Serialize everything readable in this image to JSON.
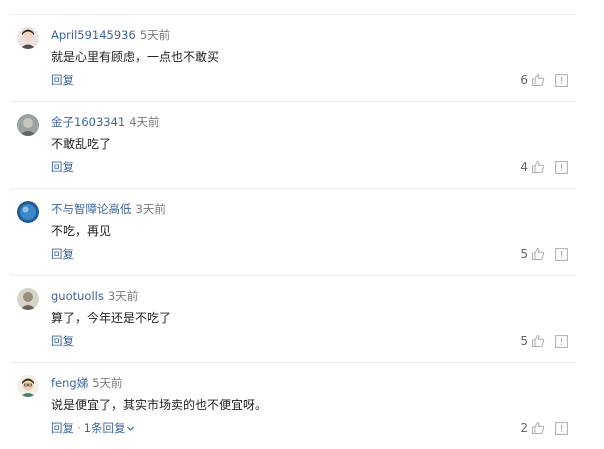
{
  "comments": [
    {
      "username": "April59145936",
      "time": "5天前",
      "content": "就是心里有顾虑，一点也不敢买",
      "reply_label": "回复",
      "likes": "6",
      "avatar_color": "#6b5a55"
    },
    {
      "username": "金子1603341",
      "time": "4天前",
      "content": "不敢乱吃了",
      "reply_label": "回复",
      "likes": "4",
      "avatar_color": "#7f8a86"
    },
    {
      "username": "不与智障论高低",
      "time": "3天前",
      "content": "不吃，再见",
      "reply_label": "回复",
      "likes": "5",
      "avatar_color": "#2e6fa8"
    },
    {
      "username": "guotuolls",
      "time": "3天前",
      "content": "算了，今年还是不吃了",
      "reply_label": "回复",
      "likes": "5",
      "avatar_color": "#8a7e73"
    },
    {
      "username": "feng娣",
      "time": "5天前",
      "content": "说是便宜了，其实市场卖的也不便宜呀。",
      "reply_label": "回复",
      "reply_sep": "·",
      "reply_count_label": "1条回复",
      "likes": "2",
      "avatar_color": "#e8c9a5"
    }
  ],
  "colors": {
    "link": "#406599",
    "divider": "#ececec",
    "icon": "#b3b3b3"
  },
  "icons": {
    "like": "thumbs-up-icon",
    "report": "report-icon",
    "expand": "chevron-down-icon"
  }
}
